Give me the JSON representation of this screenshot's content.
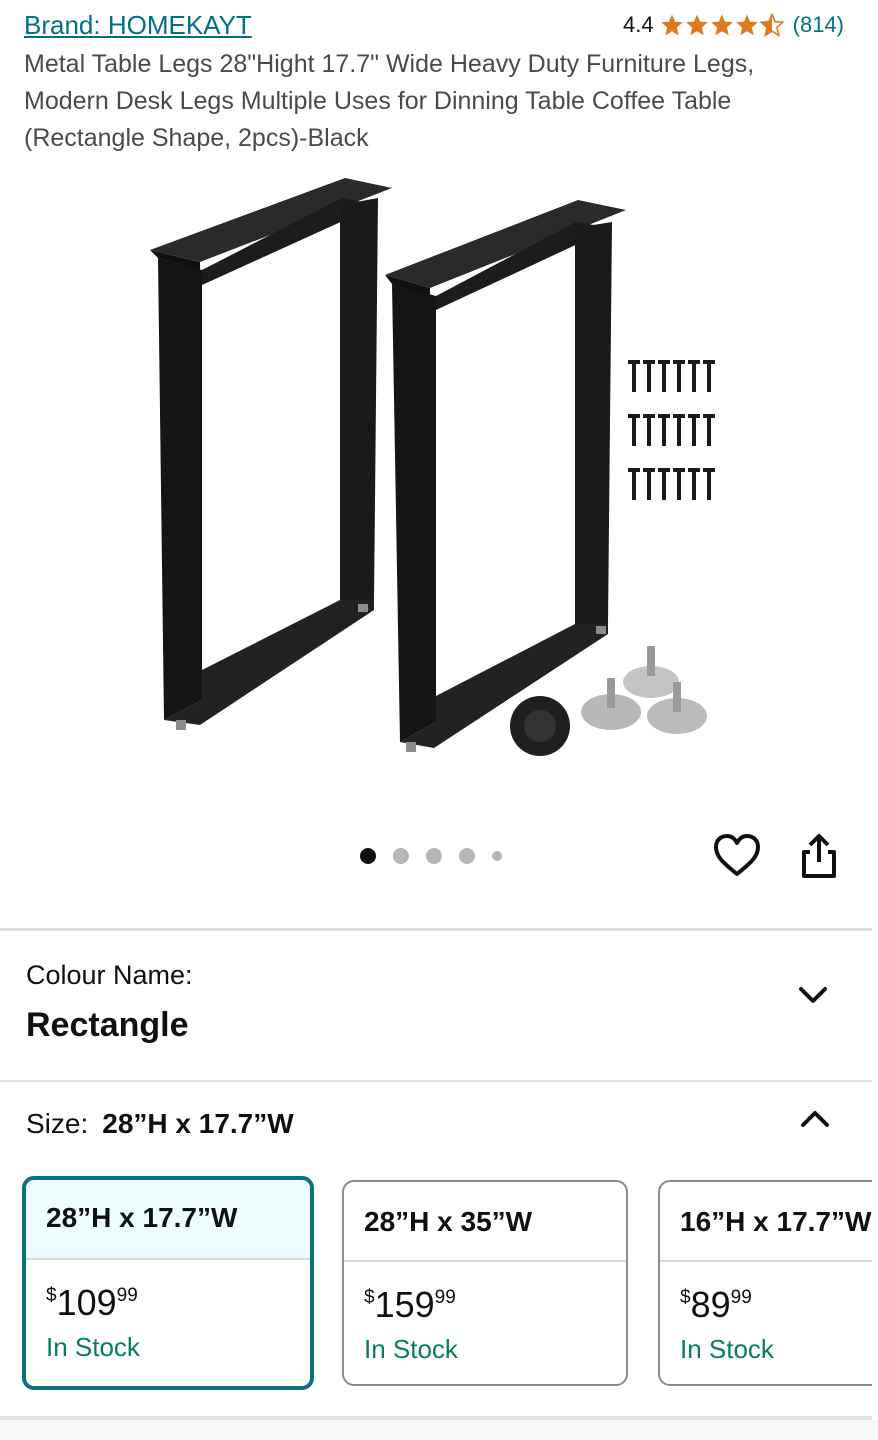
{
  "header": {
    "brand": "Brand: HOMEKAYT",
    "rating_value": "4.4",
    "rating_stars": 4.4,
    "rating_count": "(814)"
  },
  "product": {
    "title": "Metal Table Legs 28\"Hight 17.7\" Wide Heavy Duty Furniture Legs, Modern Desk Legs Multiple Uses for Dinning Table Coffee Table (Rectangle Shape, 2pcs)-Black"
  },
  "gallery": {
    "image_count": 5,
    "active_index": 0
  },
  "colour": {
    "label": "Colour Name:",
    "value": "Rectangle"
  },
  "size": {
    "label": "Size:",
    "value": "28”H x 17.7”W",
    "options": [
      {
        "name": "28”H x 17.7”W",
        "currency": "$",
        "price_whole": "109",
        "price_fraction": "99",
        "stock": "In Stock",
        "selected": true
      },
      {
        "name": "28”H x 35”W",
        "currency": "$",
        "price_whole": "159",
        "price_fraction": "99",
        "stock": "In Stock",
        "selected": false
      },
      {
        "name": "16”H x 17.7”W",
        "currency": "$",
        "price_whole": "89",
        "price_fraction": "99",
        "stock": "In Stock",
        "selected": false
      }
    ]
  },
  "colors": {
    "link": "#007185",
    "star": "#de7921",
    "stock": "#067d62",
    "selected_border": "#0e6f80"
  },
  "icons": {
    "wishlist": "heart-icon",
    "share": "share-icon",
    "colour_toggle": "chevron-down-icon",
    "size_toggle": "chevron-up-icon"
  }
}
